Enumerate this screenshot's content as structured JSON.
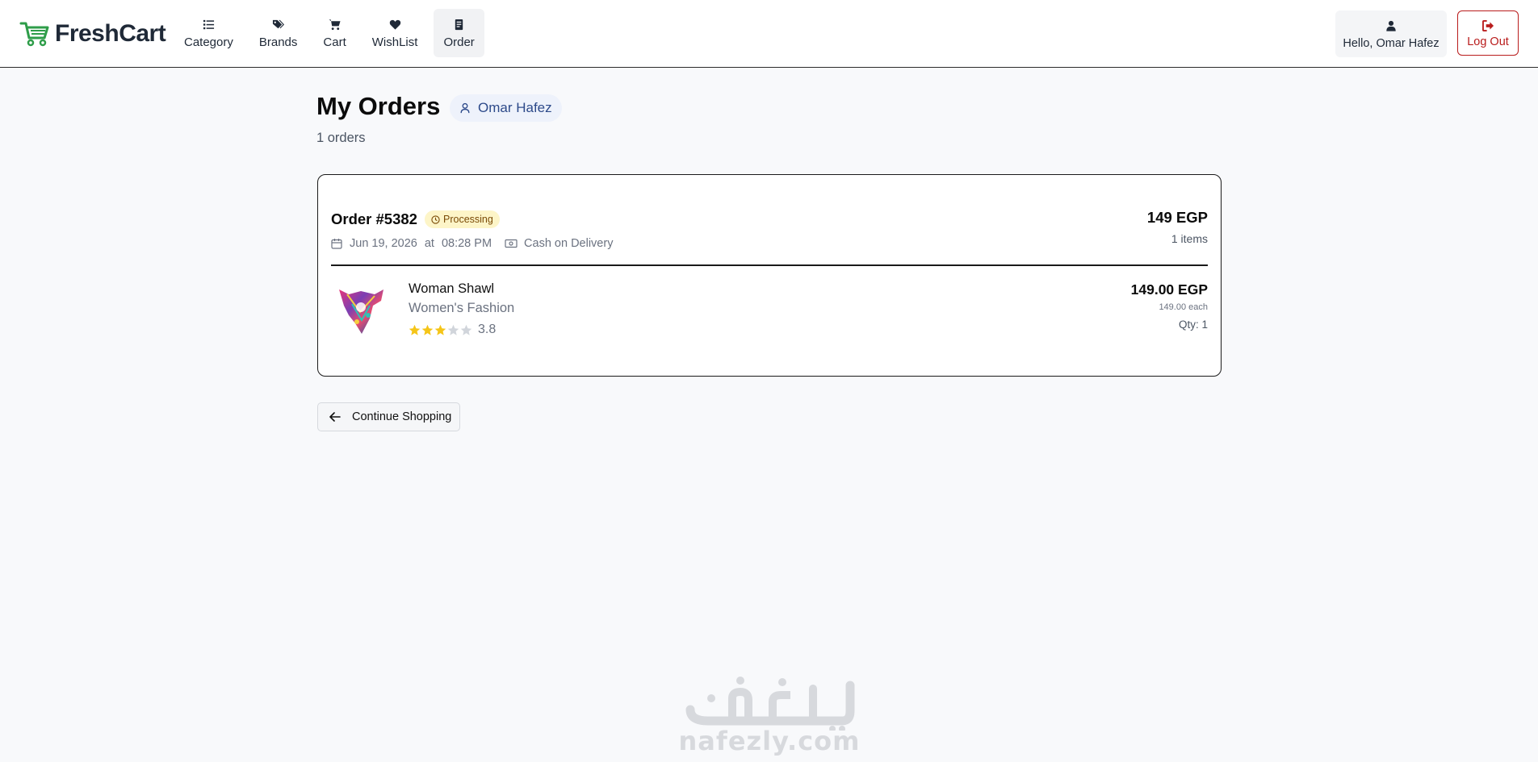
{
  "brand": {
    "name": "FreshCart",
    "color": "#2e9d49"
  },
  "nav": {
    "items": [
      {
        "label": "Category",
        "icon": "list-icon"
      },
      {
        "label": "Brands",
        "icon": "tags-icon"
      },
      {
        "label": "Cart",
        "icon": "cart-icon"
      },
      {
        "label": "WishList",
        "icon": "heart-icon"
      },
      {
        "label": "Order",
        "icon": "receipt-icon",
        "active": true
      }
    ],
    "greeting": "Hello, Omar Hafez",
    "logout_label": "Log Out"
  },
  "page": {
    "title": "My Orders",
    "user_name": "Omar Hafez",
    "order_count": "1 orders"
  },
  "order": {
    "id": "Order #5382",
    "status": "Processing",
    "date": "Jun 19, 2026",
    "at": "at",
    "time": "08:28 PM",
    "payment": "Cash on Delivery",
    "total": "149 EGP",
    "items_count": "1 items",
    "items": [
      {
        "name": "Woman Shawl",
        "category": "Women's Fashion",
        "rating": 3.8,
        "rating_label": "3.8",
        "stars_filled": 3,
        "stars_total": 5,
        "price": "149.00 EGP",
        "each": "149.00 each",
        "qty": "Qty: 1"
      }
    ]
  },
  "actions": {
    "continue_label": "Continue Shopping"
  },
  "watermark": {
    "arabic": "نفذلي",
    "latin": "nafezly.com"
  },
  "colors": {
    "danger": "#b91c1c",
    "star": "#f5c518",
    "star_empty": "#d1d5db",
    "badge_bg": "#fdf5c8",
    "badge_text": "#7a4a06",
    "chip_bg": "#eef2fb",
    "chip_text": "#2d4a8a"
  }
}
